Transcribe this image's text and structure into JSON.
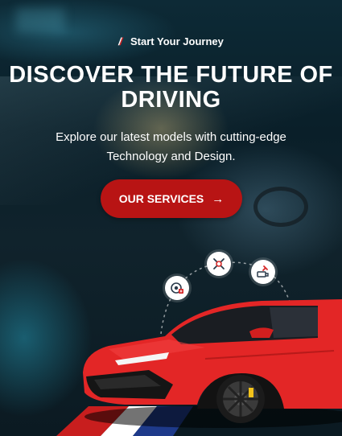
{
  "hero": {
    "tagline": "Start Your Journey",
    "title_line1": "DISCOVER THE FUTURE OF",
    "title_line2": "DRIVING",
    "subtitle_line1": "Explore our latest models with cutting-edge",
    "subtitle_line2": "Technology and Design.",
    "cta_label": "OUR SERVICES",
    "cta_arrow": "→"
  },
  "service_icons": [
    "tire-service-icon",
    "wheel-alignment-icon",
    "engine-tools-icon"
  ],
  "colors": {
    "accent": "#b81414",
    "car_body": "#e32626",
    "background_dark": "#0d2a36"
  }
}
